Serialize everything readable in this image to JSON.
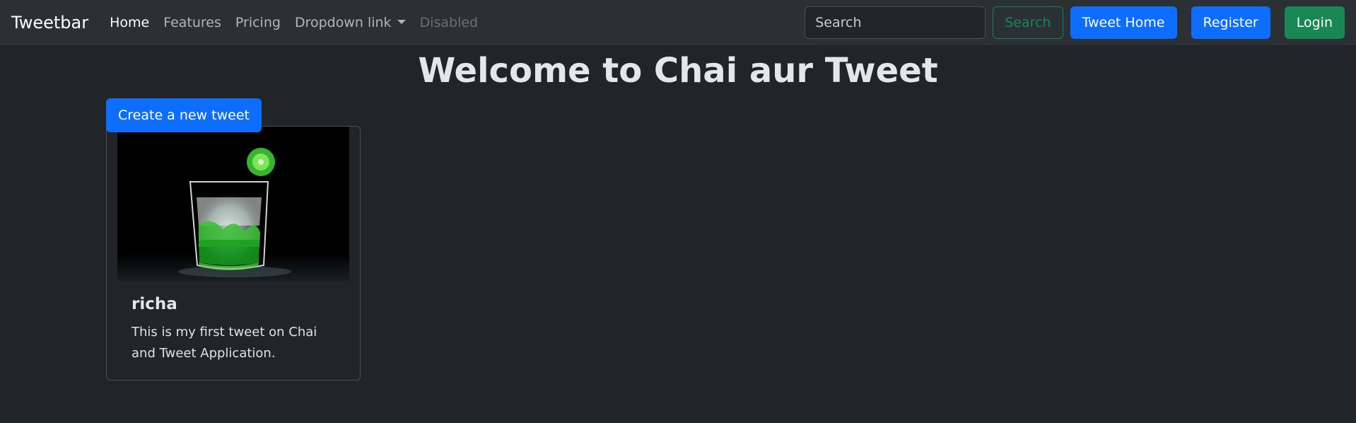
{
  "navbar": {
    "brand": "Tweetbar",
    "links": [
      {
        "label": "Home"
      },
      {
        "label": "Features"
      },
      {
        "label": "Pricing"
      },
      {
        "label": "Dropdown link"
      },
      {
        "label": "Disabled"
      }
    ],
    "search": {
      "placeholder": "Search",
      "button_label": "Search"
    },
    "tweet_home_label": "Tweet Home",
    "register_label": "Register",
    "login_label": "Login"
  },
  "main": {
    "title": "Welcome to Chai aur Tweet",
    "create_button_label": "Create a new tweet",
    "tweets": [
      {
        "username": "richa",
        "text": "This is my first tweet on Chai and Tweet Application."
      }
    ]
  },
  "colors": {
    "background": "#212529",
    "navbar": "#2b3035",
    "primary": "#0d6efd",
    "success": "#198754"
  }
}
